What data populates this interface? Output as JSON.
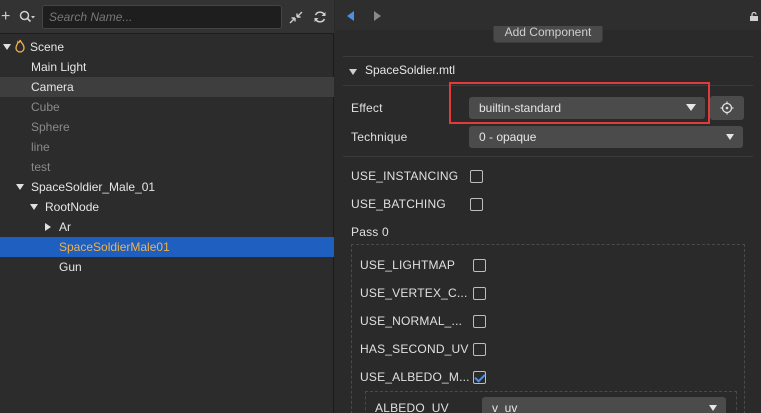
{
  "hierarchy": {
    "search_placeholder": "Search Name...",
    "toolbar": {
      "add_icon": "plus-icon",
      "search_icon": "search-icon",
      "collapse_icon": "collapse-icon",
      "refresh_icon": "refresh-icon"
    },
    "nodes": [
      {
        "label": "Scene",
        "depth": 0,
        "expanded": true,
        "icon": "scene-icon"
      },
      {
        "label": "Main Light",
        "depth": 1
      },
      {
        "label": "Camera",
        "depth": 1
      },
      {
        "label": "Cube",
        "depth": 1,
        "dim": true
      },
      {
        "label": "Sphere",
        "depth": 1,
        "dim": true
      },
      {
        "label": "line",
        "depth": 1,
        "dim": true
      },
      {
        "label": "test",
        "depth": 1,
        "dim": true
      },
      {
        "label": "SpaceSoldier_Male_01",
        "depth": 1,
        "expanded": true
      },
      {
        "label": "RootNode",
        "depth": 2,
        "expanded": true
      },
      {
        "label": "Ar",
        "depth": 3,
        "expanded": false
      },
      {
        "label": "SpaceSoldierMale01",
        "depth": 3,
        "selected": true
      },
      {
        "label": "Gun",
        "depth": 3
      }
    ]
  },
  "inspector": {
    "add_component_label": "Add Component",
    "section_title": "SpaceSoldier.mtl",
    "effect_label": "Effect",
    "effect_value": "builtin-standard",
    "technique_label": "Technique",
    "technique_value": "0 - opaque",
    "use_instancing_label": "USE_INSTANCING",
    "use_batching_label": "USE_BATCHING",
    "pass_label": "Pass 0",
    "pass_props": [
      {
        "label": "USE_LIGHTMAP",
        "checked": false
      },
      {
        "label": "USE_VERTEX_C...",
        "checked": false
      },
      {
        "label": "USE_NORMAL_...",
        "checked": false
      },
      {
        "label": "HAS_SECOND_UV",
        "checked": false
      },
      {
        "label": "USE_ALBEDO_M...",
        "checked": true
      }
    ],
    "albedo_uv_label": "ALBEDO_UV",
    "albedo_uv_value": "v_uv"
  },
  "colors": {
    "selection": "#1f5fbf",
    "selected_text": "#f0b24a",
    "highlight_box": "#e33b3b",
    "accent": "#4d8fe6"
  }
}
